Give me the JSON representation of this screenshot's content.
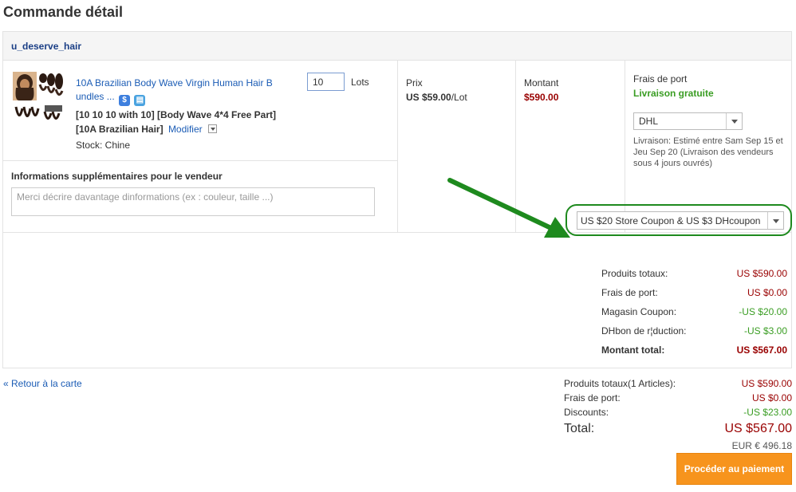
{
  "page": {
    "title": "Commande détail"
  },
  "seller": {
    "name": "u_deserve_hair"
  },
  "product": {
    "title": "10A Brazilian Body Wave Virgin Human Hair B undles ...",
    "quantity": "10",
    "unit": "Lots",
    "variant": "[10 10 10 with 10] [Body Wave 4*4 Free Part] [10A Brazilian Hair]",
    "modify_label": "Modifier",
    "stock": "Stock: Chine",
    "badges": [
      "dollar-badge-icon",
      "shipping-badge-icon"
    ]
  },
  "seller_note": {
    "label": "Informations supplémentaires pour le vendeur",
    "placeholder": "Merci décrire davantage dinformations (ex : couleur, taille ...)"
  },
  "price": {
    "label": "Prix",
    "value": "US $59.00",
    "unit": "/Lot"
  },
  "amount": {
    "label": "Montant",
    "value": "$590.00"
  },
  "shipping": {
    "label": "Frais de port",
    "free": "Livraison gratuite",
    "carrier": "DHL",
    "note": "Livraison: Estimé entre Sam Sep 15 et Jeu Sep 20 (Livraison des vendeurs sous 4 jours ouvrés)"
  },
  "coupon": {
    "selected": "US $20 Store Coupon & US $3 DHcoupon"
  },
  "store_summary": [
    {
      "label": "Produits totaux:",
      "value": "US $590.00"
    },
    {
      "label": "Frais de port:",
      "value": "US $0.00"
    },
    {
      "label": "Magasin Coupon:",
      "value": "-US $20.00"
    },
    {
      "label": "DHbon de r¦duction:",
      "value": "-US $3.00"
    },
    {
      "label": "Montant total:",
      "value": "US $567.00"
    }
  ],
  "back_link": "« Retour à la carte",
  "totals": {
    "products": {
      "label": "Produits totaux(1 Articles):",
      "value": "US $590.00"
    },
    "shipping": {
      "label": "Frais de port:",
      "value": "US $0.00"
    },
    "discounts": {
      "label": "Discounts:",
      "value": "-US $23.00"
    },
    "total": {
      "label": "Total:",
      "value": "US $567.00"
    },
    "eur": "EUR € 496.18"
  },
  "pay_button": "Procéder au paiement",
  "colors": {
    "link": "#1b5cb5",
    "price_red": "#990000",
    "green": "#3a9d23",
    "pay_orange": "#f7941d",
    "annotation_green": "#1e8a1e"
  }
}
